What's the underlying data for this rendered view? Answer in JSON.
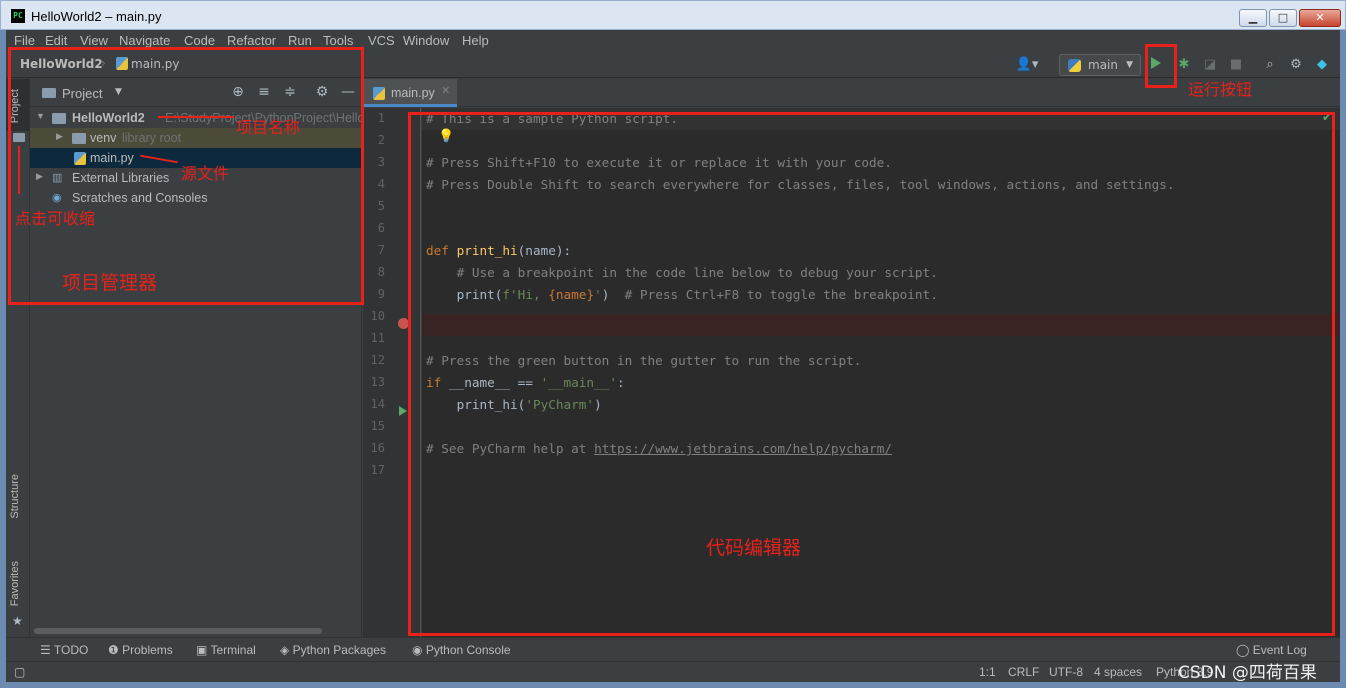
{
  "window": {
    "title": "HelloWorld2 – main.py",
    "app_icon": "PC",
    "minimize": "▁",
    "maximize": "□",
    "close": "✕"
  },
  "menu": [
    "File",
    "Edit",
    "View",
    "Navigate",
    "Code",
    "Refactor",
    "Run",
    "Tools",
    "VCS",
    "Window",
    "Help"
  ],
  "breadcrumb": {
    "project": "HelloWorld2",
    "file": "main.py"
  },
  "toolbar": {
    "run_config": "main"
  },
  "stripe": {
    "project_tab": "Project",
    "structure_tab": "Structure",
    "favorites_tab": "Favorites"
  },
  "project_panel": {
    "title": "Project",
    "tree": {
      "root_name": "HelloWorld2",
      "root_path": "E:\\StudyProject\\PythonProject\\Hello",
      "venv": "venv",
      "venv_note": "library root",
      "main_file": "main.py",
      "external": "External Libraries",
      "scratches": "Scratches and Consoles"
    }
  },
  "editor": {
    "tab_label": "main.py",
    "line_numbers": [
      "1",
      "2",
      "3",
      "4",
      "5",
      "6",
      "7",
      "8",
      "9",
      "10",
      "11",
      "12",
      "13",
      "14",
      "15",
      "16",
      "17"
    ],
    "code": {
      "l1": "# This is a sample Python script.",
      "l3": "# Press Shift+F10 to execute it or replace it with your code.",
      "l4": "# Press Double Shift to search everywhere for classes, files, tool windows, actions, and settings.",
      "l7_kw": "def",
      "l7_fn": "print_hi",
      "l7_rest": "(name):",
      "l8": "# Use a breakpoint in the code line below to debug your script.",
      "l9_a": "print(",
      "l9_s1": "f'Hi, ",
      "l9_b": "{name}",
      "l9_s2": "'",
      "l9_c": ")  ",
      "l9_cm": "# Press Ctrl+F8 to toggle the breakpoint.",
      "l12": "# Press the green button in the gutter to run the script.",
      "l13_kw": "if",
      "l13_a": " __name__ == ",
      "l13_s": "'__main__'",
      "l13_b": ":",
      "l14_a": "print_hi(",
      "l14_s": "'PyCharm'",
      "l14_b": ")",
      "l16_a": "# See PyCharm help at ",
      "l16_link": "https://www.jetbrains.com/help/pycharm/"
    }
  },
  "tool_windows": [
    "TODO",
    "Problems",
    "Terminal",
    "Python Packages",
    "Python Console"
  ],
  "event_log": "Event Log",
  "status": {
    "pos": "1:1",
    "line_sep": "CRLF",
    "encoding": "UTF-8",
    "indent": "4 spaces",
    "interpreter": "Python 3.9"
  },
  "annotations": {
    "run_button": "运行按钮",
    "project_name": "项目名称",
    "source_file": "源文件",
    "collapse": "点击可收缩",
    "project_manager": "项目管理器",
    "code_editor": "代码编辑器"
  },
  "watermark": "CSDN @四荷百果",
  "colors": {
    "annotation_red": "#e8211b",
    "accent_blue": "#4a88c7",
    "run_green": "#59a869"
  }
}
